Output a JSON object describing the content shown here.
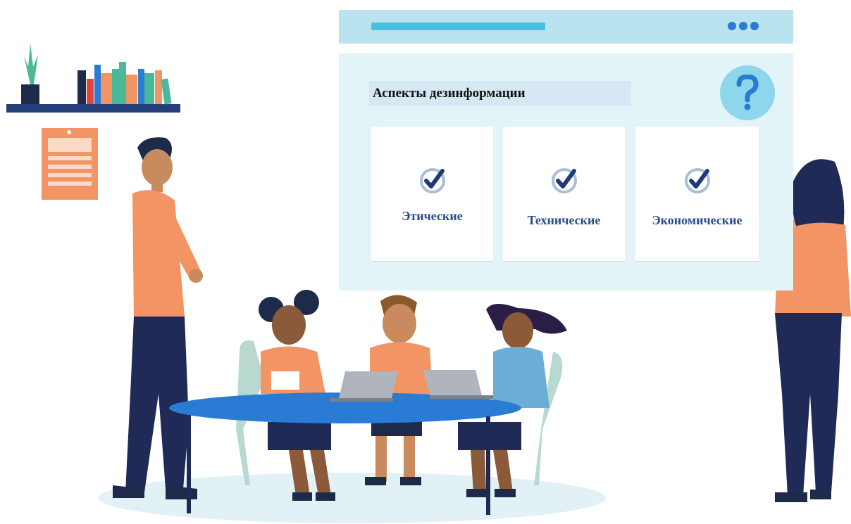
{
  "window": {
    "title": "Аспекты дезинформации",
    "menu_icon": "more-dots-icon",
    "help_icon": "question-mark-icon"
  },
  "cards": [
    {
      "label": "Этические",
      "icon": "check-circle-icon"
    },
    {
      "label": "Технические",
      "icon": "check-circle-icon"
    },
    {
      "label": "Экономические",
      "icon": "check-circle-icon"
    }
  ],
  "colors": {
    "window_bar": "#b8e3ef",
    "window_body": "#e3f4f9",
    "title_bg": "#d6e8f3",
    "card_label": "#2a4a8a",
    "accent_blue": "#2a7bd4",
    "orange": "#f29463",
    "navy": "#1f2a56"
  }
}
